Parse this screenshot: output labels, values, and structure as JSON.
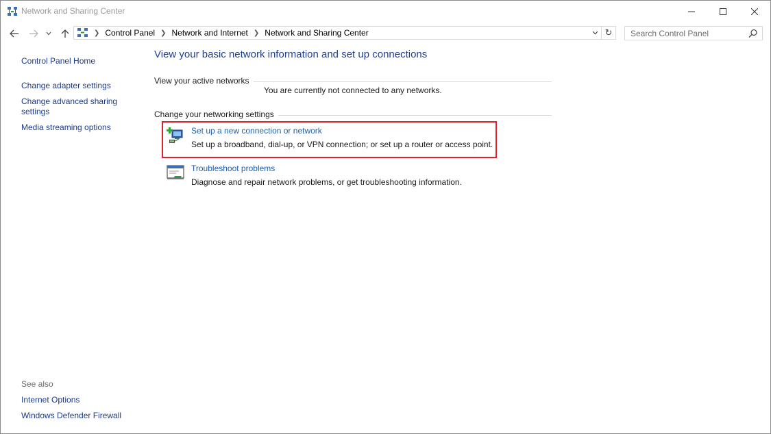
{
  "window": {
    "title": "Network and Sharing Center"
  },
  "titlebar": {
    "minimize_icon": "minimize-icon",
    "maximize_icon": "maximize-icon",
    "close_icon": "close-icon"
  },
  "nav": {
    "breadcrumbs": [
      "Control Panel",
      "Network and Internet",
      "Network and Sharing Center"
    ],
    "search_placeholder": "Search Control Panel",
    "search_value": ""
  },
  "left_pane": {
    "home": "Control Panel Home",
    "links": [
      "Change adapter settings",
      "Change advanced sharing settings",
      "Media streaming options"
    ],
    "see_also_label": "See also",
    "see_also": [
      "Internet Options",
      "Windows Defender Firewall"
    ]
  },
  "main": {
    "title": "View your basic network information and set up connections",
    "active_networks_heading": "View your active networks",
    "active_networks_status": "You are currently not connected to any networks.",
    "settings_heading": "Change your networking settings",
    "tasks": [
      {
        "link": "Set up a new connection or network",
        "description": "Set up a broadband, dial-up, or VPN connection; or set up a router or access point.",
        "icon": "new-connection-icon"
      },
      {
        "link": "Troubleshoot problems",
        "description": "Diagnose and repair network problems, or get troubleshooting information.",
        "icon": "troubleshoot-icon"
      }
    ]
  },
  "colors": {
    "link_blue": "#1a5fb4",
    "title_blue": "#1e3f94",
    "highlight_red": "#e0202a"
  }
}
